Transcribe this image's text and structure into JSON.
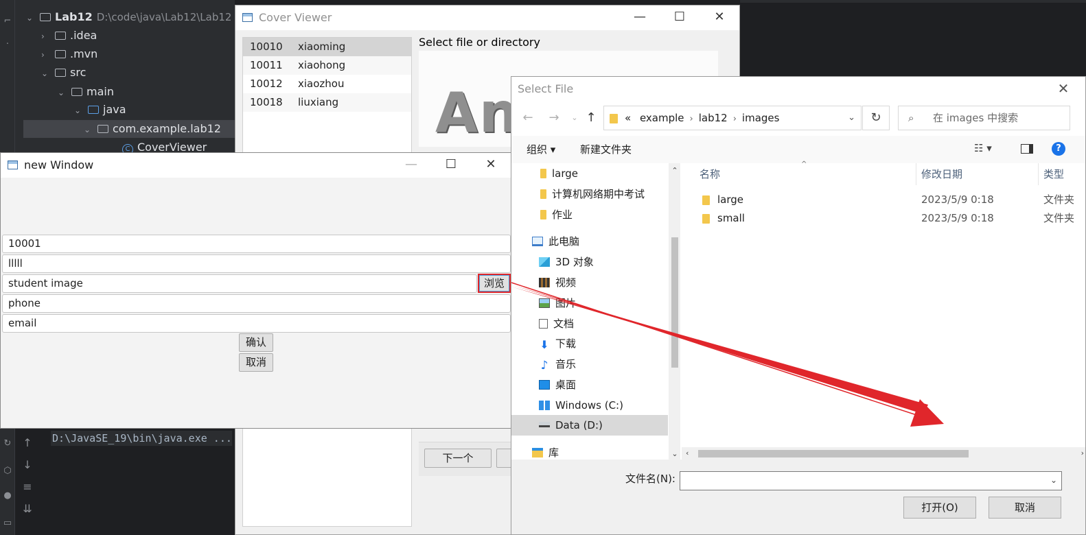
{
  "ide": {
    "project_name": "Lab12",
    "project_path": "D:\\code\\java\\Lab12\\Lab12",
    "tree": [
      {
        "label": ".idea"
      },
      {
        "label": ".mvn"
      },
      {
        "label": "src"
      },
      {
        "label": "main"
      },
      {
        "label": "java"
      },
      {
        "label": "com.example.lab12"
      },
      {
        "label": "CoverViewer"
      }
    ],
    "console_line": "D:\\JavaSE_19\\bin\\java.exe ..."
  },
  "cover_viewer": {
    "title": "Cover Viewer",
    "list": [
      {
        "id": "10010",
        "name": "xiaoming"
      },
      {
        "id": "10011",
        "name": "xiaohong"
      },
      {
        "id": "10012",
        "name": "xiaozhou"
      },
      {
        "id": "10018",
        "name": "liuxiang"
      }
    ],
    "select_label": "Select file or directory",
    "preview_text": "Ang",
    "next_button": "下一个"
  },
  "new_window": {
    "title": "new Window",
    "fields": {
      "id": "10001",
      "name": "lllll",
      "image": "student image",
      "phone": "phone",
      "email": "email"
    },
    "browse_button": "浏览",
    "confirm_button": "确认",
    "cancel_button": "取消"
  },
  "file_dialog": {
    "title": "Select File",
    "breadcrumb_prefix": "«",
    "breadcrumb": [
      "example",
      "lab12",
      "images"
    ],
    "search_placeholder": "在 images 中搜索",
    "organize": "组织 ▾",
    "new_folder": "新建文件夹",
    "nav_items": [
      {
        "label": "large",
        "icon": "folder"
      },
      {
        "label": "计算机网络期中考试",
        "icon": "folder"
      },
      {
        "label": "作业",
        "icon": "folder"
      },
      {
        "label": "此电脑",
        "icon": "pc"
      },
      {
        "label": "3D 对象",
        "icon": "cube"
      },
      {
        "label": "视频",
        "icon": "film"
      },
      {
        "label": "图片",
        "icon": "pic"
      },
      {
        "label": "文档",
        "icon": "doc"
      },
      {
        "label": "下载",
        "icon": "down"
      },
      {
        "label": "音乐",
        "icon": "music"
      },
      {
        "label": "桌面",
        "icon": "desk"
      },
      {
        "label": "Windows (C:)",
        "icon": "win"
      },
      {
        "label": "Data (D:)",
        "icon": "drive"
      },
      {
        "label": "库",
        "icon": "lib"
      }
    ],
    "columns": {
      "name": "名称",
      "date": "修改日期",
      "type": "类型"
    },
    "files": [
      {
        "name": "large",
        "date": "2023/5/9 0:18",
        "type": "文件夹"
      },
      {
        "name": "small",
        "date": "2023/5/9 0:18",
        "type": "文件夹"
      }
    ],
    "filename_label": "文件名(N):",
    "filename_value": "",
    "open_button": "打开(O)",
    "cancel_button": "取消"
  },
  "colors": {
    "annotation_red": "#e0262b",
    "ide_bg": "#1e1f22",
    "folder_yellow": "#f3c74c"
  }
}
